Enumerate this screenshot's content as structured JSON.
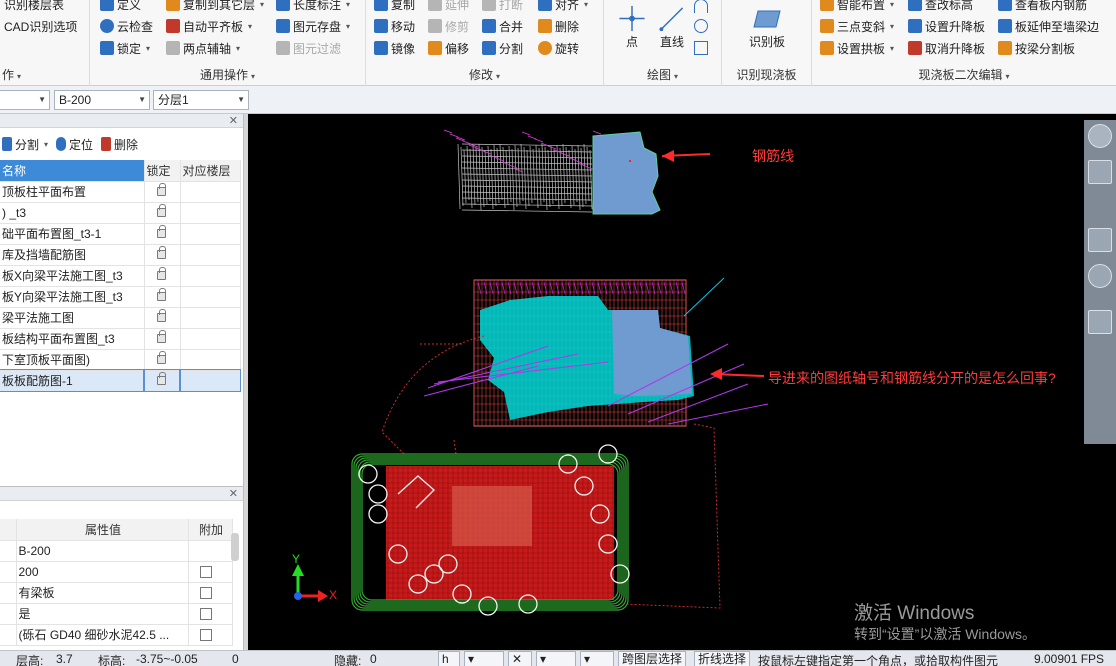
{
  "ribbon": {
    "g1": {
      "items": [
        "识别楼层表",
        "CAD识别选项"
      ],
      "label": "作"
    },
    "g2": {
      "col1": [
        "定义",
        "云检查",
        "锁定"
      ],
      "col2": [
        "复制到其它层",
        "自动平齐板",
        "两点辅轴"
      ],
      "col3": [
        "长度标注",
        "图元存盘",
        "图元过滤"
      ],
      "label": "通用操作"
    },
    "g3": {
      "col1": [
        "复制",
        "移动",
        "镜像"
      ],
      "col2": [
        "延伸",
        "修剪",
        "偏移"
      ],
      "col3": [
        "打断",
        "合并",
        "分割"
      ],
      "col4": [
        "对齐",
        "删除",
        "旋转"
      ],
      "label": "修改"
    },
    "g4": {
      "big": [
        "点",
        "直线"
      ],
      "label": "绘图"
    },
    "g5": {
      "big": "识别板",
      "label": "识别现浇板"
    },
    "g6": {
      "col1": [
        "智能布置",
        "三点变斜",
        "设置拱板"
      ],
      "col2": [
        "查改标高",
        "设置升降板",
        "取消升降板"
      ],
      "col3": [
        "查看板内钢筋",
        "板延伸至墙梁边",
        "按梁分割板"
      ],
      "label": "现浇板二次编辑"
    }
  },
  "toolbar2": {
    "combo_blank": "",
    "combo_slab": "B-200",
    "combo_layer": "分层1"
  },
  "layer_panel": {
    "tools": [
      "分割",
      "定位",
      "删除"
    ],
    "columns": [
      "名称",
      "锁定",
      "对应楼层"
    ],
    "rows": [
      "顶板柱平面布置",
      ") _t3",
      "础平面布置图_t3-1",
      "库及挡墙配筋图",
      "板X向梁平法施工图_t3",
      "板Y向梁平法施工图_t3",
      "梁平法施工图",
      "板结构平面布置图_t3",
      "下室顶板平面图)",
      "板板配筋图-1"
    ],
    "selected_index": 9
  },
  "property_panel": {
    "columns": [
      "属性值",
      "附加"
    ],
    "rows": [
      {
        "value": "B-200",
        "checkbox": false
      },
      {
        "value": "200",
        "checkbox": true
      },
      {
        "value": "有梁板",
        "checkbox": true
      },
      {
        "value": "是",
        "checkbox": true
      },
      {
        "value": "(砾石 GD40 细砂水泥42.5 ...",
        "checkbox": true
      }
    ]
  },
  "viewport": {
    "annotation_rebar": "钢筋线",
    "annotation_question": "导进来的图纸轴号和钢筋线分开的是怎么回事?",
    "axis_y": "Y",
    "axis_x": "X",
    "watermark_title": "激活 Windows",
    "watermark_sub": "转到“设置”以激活 Windows。"
  },
  "status": {
    "floor_height_label": "层高:",
    "floor_height": "3.7",
    "elevation_label": "标高:",
    "elevation": "-3.75~-0.05",
    "count": "0",
    "hidden_label": "隐藏:",
    "hidden": "0",
    "cross_layer": "跨图层选择",
    "polyline_select": "折线选择",
    "hint": "按鼠标左键指定第一个角点，或拾取构件图元",
    "fps": "9.00901 FPS"
  },
  "colors": {
    "accent": "#3c8ad8",
    "viewport_bg": "#000000",
    "annotation": "#ff3b3b",
    "slab_fill": "#6f9bd1",
    "rebar_cyan": "#00e5e5",
    "red_block": "#c81a1a",
    "green_lines": "#2fa82f"
  }
}
